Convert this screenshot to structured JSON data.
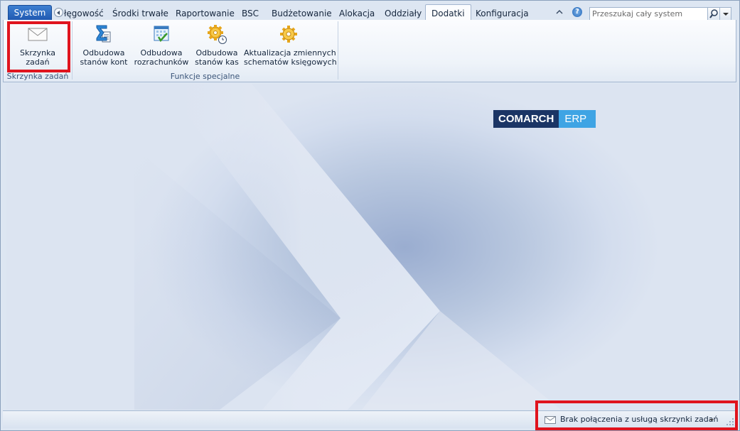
{
  "app_menu_label": "System",
  "tabs": [
    {
      "label": "łęgowość",
      "active": false
    },
    {
      "label": "Środki trwałe",
      "active": false
    },
    {
      "label": "Raportowanie",
      "active": false
    },
    {
      "label": "BSC",
      "active": false
    },
    {
      "label": "Budżetowanie",
      "active": false
    },
    {
      "label": "Alokacja",
      "active": false
    },
    {
      "label": "Oddziały",
      "active": false
    },
    {
      "label": "Dodatki",
      "active": true
    },
    {
      "label": "Konfiguracja",
      "active": false
    }
  ],
  "search": {
    "placeholder": "Przeszukaj cały system"
  },
  "ribbon": {
    "groups": [
      {
        "label": "Skrzynka zadań",
        "buttons": [
          {
            "line1": "Skrzynka",
            "line2": "zadań",
            "icon": "envelope-icon"
          }
        ]
      },
      {
        "label": "Funkcje specjalne",
        "buttons": [
          {
            "line1": "Odbudowa",
            "line2": "stanów kont",
            "icon": "sigma-sheet-icon"
          },
          {
            "line1": "Odbudowa",
            "line2": "rozrachunków",
            "icon": "calendar-check-icon"
          },
          {
            "line1": "Odbudowa",
            "line2": "stanów kas",
            "icon": "gear-clock-icon"
          },
          {
            "line1": "Aktualizacja zmiennych",
            "line2": "schematów księgowych",
            "icon": "gear-icon"
          }
        ]
      }
    ]
  },
  "logo": {
    "part1": "COMARCH",
    "part2": "ERP"
  },
  "status": {
    "text": "Brak połączenia z usługą skrzynki zadań",
    "icon": "envelope-icon"
  },
  "colors": {
    "highlight": "#e0141e",
    "app_menu": "#2a67c0",
    "logo_dark": "#1b3565",
    "logo_light": "#3fa4e4"
  }
}
